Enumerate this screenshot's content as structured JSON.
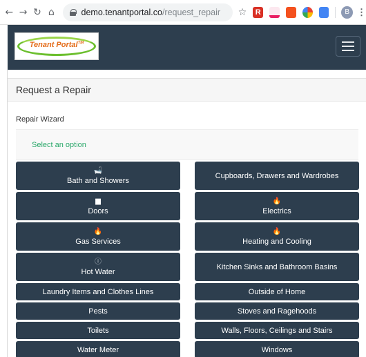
{
  "browser": {
    "url_host": "demo.tenantportal.co",
    "url_path": "/request_repair",
    "ext_r_label": "R",
    "profile_initial": "B"
  },
  "navbar": {
    "logo_text": "Tenant Portal",
    "logo_tm": "TM"
  },
  "page": {
    "title": "Request a Repair",
    "wizard_label": "Repair Wizard",
    "select_prompt": "Select an option"
  },
  "options": [
    {
      "label": "Bath and Showers",
      "icon": "bath-icon",
      "glyph": "🛁"
    },
    {
      "label": "Cupboards, Drawers and Wardrobes",
      "icon": "",
      "glyph": ""
    },
    {
      "label": "Doors",
      "icon": "door-icon",
      "glyph": "▆"
    },
    {
      "label": "Electrics",
      "icon": "flame-icon",
      "glyph": "🔥"
    },
    {
      "label": "Gas Services",
      "icon": "flame-icon",
      "glyph": "🔥"
    },
    {
      "label": "Heating and Cooling",
      "icon": "fire-icon",
      "glyph": "🔥"
    },
    {
      "label": "Hot Water",
      "icon": "info-icon",
      "glyph": "ⓘ"
    },
    {
      "label": "Kitchen Sinks and Bathroom Basins",
      "icon": "",
      "glyph": ""
    },
    {
      "label": "Laundry Items and Clothes Lines",
      "icon": "",
      "glyph": ""
    },
    {
      "label": "Outside of Home",
      "icon": "",
      "glyph": ""
    },
    {
      "label": "Pests",
      "icon": "",
      "glyph": ""
    },
    {
      "label": "Stoves and Ragehoods",
      "icon": "",
      "glyph": ""
    },
    {
      "label": "Toilets",
      "icon": "",
      "glyph": ""
    },
    {
      "label": "Walls, Floors, Ceilings and Stairs",
      "icon": "",
      "glyph": ""
    },
    {
      "label": "Water Meter",
      "icon": "",
      "glyph": ""
    },
    {
      "label": "Windows",
      "icon": "",
      "glyph": ""
    }
  ],
  "colors": {
    "navbar": "#2d3e4e",
    "accent_green": "#2aa86a",
    "logo_orange": "#e46c1a"
  }
}
